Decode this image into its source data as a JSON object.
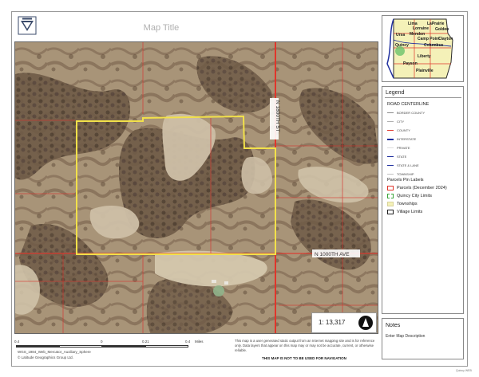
{
  "map": {
    "title": "Map Title",
    "scale_text": "1: 13,317",
    "road_labels": [
      {
        "text": "N 1800TH ST"
      },
      {
        "text": "N 1000TH AVE"
      }
    ]
  },
  "overview": {
    "places": [
      "Lima",
      "LaPrairie",
      "Lorraine",
      "Golden",
      "Ursa",
      "Mendon",
      "Camp Point",
      "Clayton",
      "Quincy",
      "Columbus",
      "Liberty",
      "Payson",
      "Plainville"
    ]
  },
  "legend": {
    "title": "Legend",
    "road_centerline_heading": "ROAD CENTERLINE",
    "road_items": [
      {
        "label": "BORDER COUNTY",
        "color": "#8a8a8a"
      },
      {
        "label": "CITY",
        "color": "#b0b0b0"
      },
      {
        "label": "COUNTY",
        "color": "#e0352b"
      },
      {
        "label": "INTERSTATE",
        "color": "#1f2f9e"
      },
      {
        "label": "PRIVATE",
        "color": "#dddddd"
      },
      {
        "label": "STATE",
        "color": "#1f2f9e"
      },
      {
        "label": "STATE & LANE",
        "color": "#1f2f9e"
      },
      {
        "label": "TOWNSHIP",
        "color": "#c0c0c0"
      }
    ],
    "layer_items": [
      {
        "label": "Parcels Pin Labels",
        "symbol": "none"
      },
      {
        "label": "Parcels (December 2024)",
        "symbol": "square-outline",
        "color": "#e0352b"
      },
      {
        "label": "Quincy City Limits",
        "symbol": "square-dashed",
        "color": "#3aa63a"
      },
      {
        "label": "Townships",
        "symbol": "square-fill",
        "color": "#f4f1b8"
      },
      {
        "label": "Village Limits",
        "symbol": "square-outline",
        "color": "#222222"
      }
    ]
  },
  "notes": {
    "title": "Notes",
    "description": "Enter Map Description"
  },
  "scalebar": {
    "ticks": [
      "0.4",
      "0",
      "0.21",
      "0.4"
    ],
    "unit": "Miles"
  },
  "footer": {
    "crs": "WGS_1984_Web_Mercator_Auxiliary_Sphere",
    "copyright": "© Latitude Geographics Group Ltd.",
    "disclaimer": "This map is a user generated static output from an Internet mapping site and is for reference only. Data layers that appear on this map may or may not be accurate, current, or otherwise reliable.",
    "navigation_note": "THIS MAP IS NOT TO BE USED FOR NAVIGATION",
    "code": "Quincy WEB"
  },
  "colors": {
    "parcel_boundary": "#f2e14a",
    "county_road": "#e0352b",
    "parcel_lines": "#d8322c"
  }
}
